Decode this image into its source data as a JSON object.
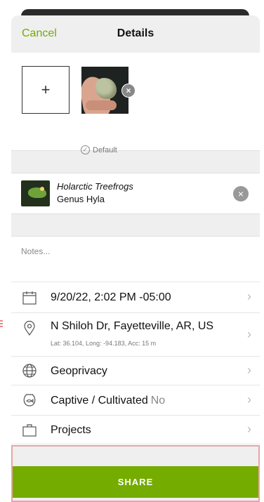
{
  "nav": {
    "cancel_label": "Cancel",
    "title": "Details"
  },
  "photos": {
    "add_symbol": "+",
    "default_label": "Default",
    "close_symbol": "×"
  },
  "taxon": {
    "common_name": "Holarctic Treefrogs",
    "rank_name": "Genus Hyla",
    "clear_symbol": "×"
  },
  "notes": {
    "placeholder": "Notes..."
  },
  "rows": {
    "date": {
      "label": "9/20/22, 2:02 PM -05:00",
      "icon": "calendar-icon"
    },
    "location": {
      "label": "N Shiloh Dr, Fayetteville, AR, US",
      "sub": "Lat: 36.104, Long: -94.183, Acc: 15 m",
      "icon": "location-pin-icon"
    },
    "geoprivacy": {
      "label": "Geoprivacy",
      "icon": "globe-icon"
    },
    "captive": {
      "label": "Captive / Cultivated",
      "value": "No",
      "icon": "fishbowl-icon"
    },
    "projects": {
      "label": "Projects",
      "icon": "briefcase-icon"
    }
  },
  "share": {
    "label": "SHARE"
  },
  "colors": {
    "accent": "#74ac00"
  }
}
